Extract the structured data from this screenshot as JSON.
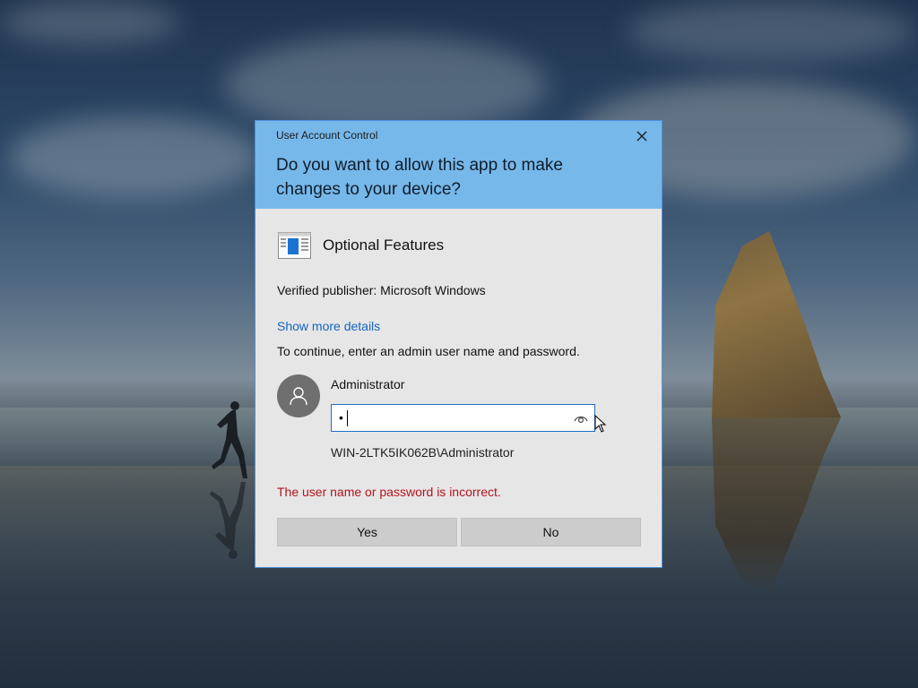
{
  "dialog": {
    "caption": "User Account Control",
    "question": "Do you want to allow this app to make changes to your device?",
    "close_icon": "close-icon",
    "app": {
      "icon": "optional-features-icon",
      "name": "Optional Features"
    },
    "publisher": "Verified publisher: Microsoft Windows",
    "details_link": "Show more details",
    "instructions": "To continue, enter an admin user name and password.",
    "credentials": {
      "avatar_icon": "user-avatar-icon",
      "user_name": "Administrator",
      "password_value": "•",
      "reveal_icon": "eye-icon",
      "domain_user": "WIN-2LTK5IK062B\\Administrator"
    },
    "error": "The user name or password is incorrect.",
    "buttons": {
      "yes": "Yes",
      "no": "No"
    }
  },
  "colors": {
    "header_bg": "#77b8ea",
    "dialog_bg": "#e6e6e6",
    "link": "#1565c0",
    "error": "#b4141e",
    "button_bg": "#cccccc",
    "input_border": "#1e6fc2"
  }
}
